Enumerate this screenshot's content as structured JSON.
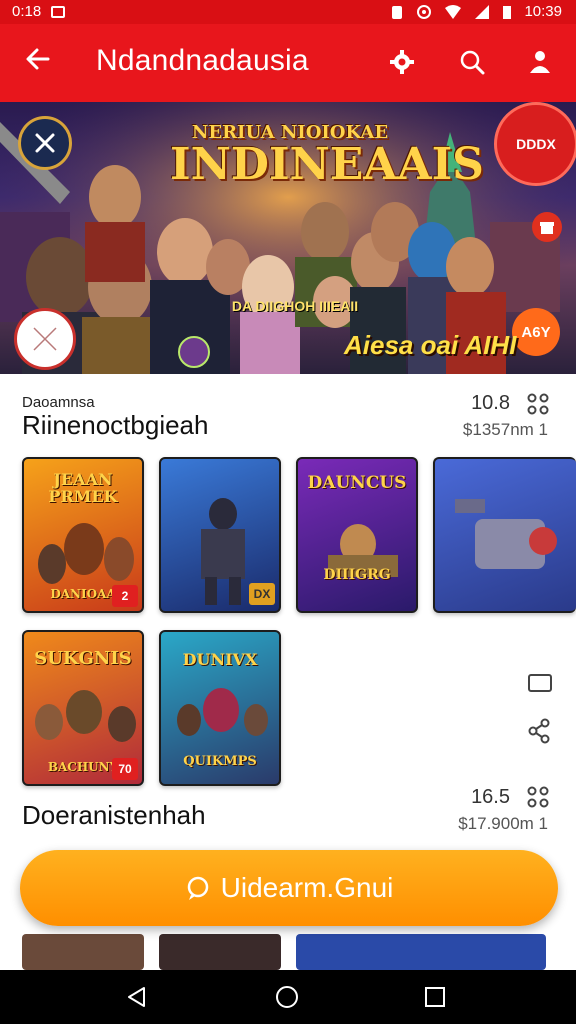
{
  "status_bar": {
    "time_left": "0:18",
    "time_right": "10:39"
  },
  "app_bar": {
    "title": "Ndandnadausia"
  },
  "banner": {
    "title_line1": "NERIUA NIOIOKAE",
    "title_line2": "INDINEAAIS",
    "subtitle": "DA DIIGHOH IIIEAII",
    "footer_text": "Aiesa oai AIHI",
    "top_right_badge": "DDDX",
    "bottom_right_badge": "A6Y"
  },
  "section1": {
    "category": "Daoamnsa",
    "title": "Riinenoctbgieah",
    "count": "10.8",
    "price": "$1357nm 1"
  },
  "cards_row1": [
    {
      "title": "JEAAN PRMEK",
      "caption": "DANIOAA",
      "badge": "2"
    },
    {
      "title": "",
      "caption": "",
      "badge": "DX"
    },
    {
      "title": "DAUNCUS",
      "caption": "DIIIGRG",
      "badge": ""
    },
    {
      "title": "",
      "caption": "",
      "badge": ""
    }
  ],
  "cards_row2": [
    {
      "title": "SUKGNIS",
      "caption": "BACHUNY",
      "badge": "70"
    },
    {
      "title": "DUNIVX",
      "caption": "QUIKMPS",
      "badge": ""
    }
  ],
  "section2": {
    "title": "Doeranistenhah",
    "count": "16.5",
    "price": "$17.900m 1"
  },
  "cta": {
    "label": "Uidearm.Gnui"
  },
  "colors": {
    "brand_red": "#e8161c",
    "cta_orange": "#ff9b0f"
  }
}
